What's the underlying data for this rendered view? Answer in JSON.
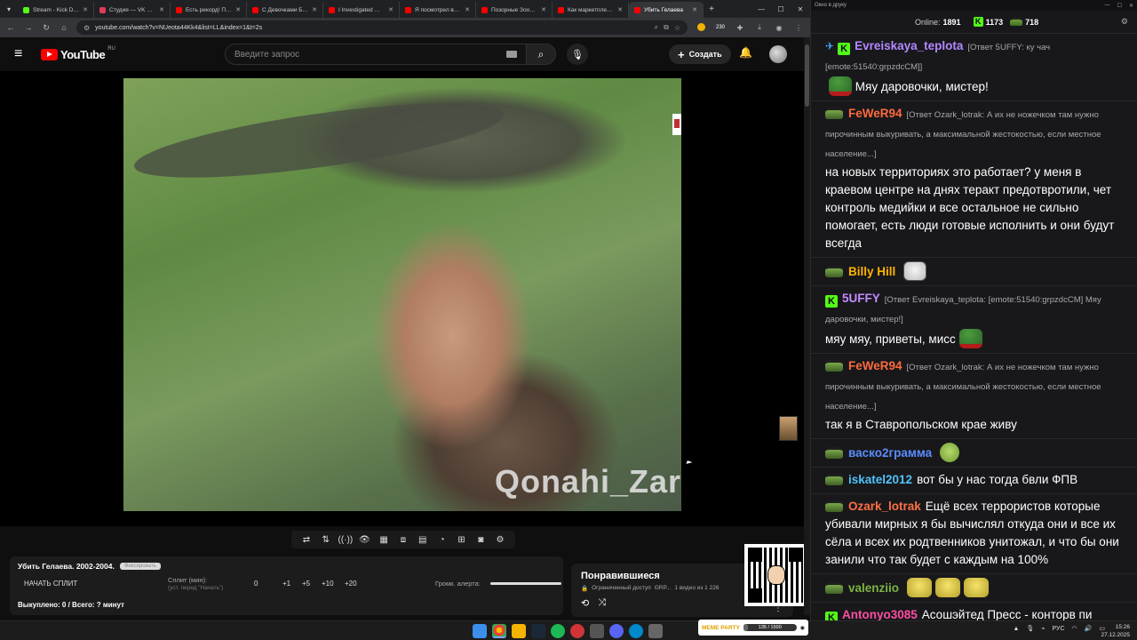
{
  "browser": {
    "tabs": [
      {
        "label": "Stream - Kick Dash",
        "color": "#53fc18",
        "active": false
      },
      {
        "label": "Студия — VK Видео",
        "color": "#e33b5a",
        "active": false
      },
      {
        "label": "Есть рекорд! Пере",
        "color": "#ff0000",
        "active": false
      },
      {
        "label": "С Девочками Бол",
        "color": "#ff0000",
        "active": false
      },
      {
        "label": "I Investigated Mine",
        "color": "#ff0000",
        "active": false
      },
      {
        "label": "Я посмотрел все о",
        "color": "#ff0000",
        "active": false
      },
      {
        "label": "Позорные Зоозащ",
        "color": "#ff0000",
        "active": false
      },
      {
        "label": "Как маркетплейсы",
        "color": "#ff0000",
        "active": false
      },
      {
        "label": "Убить Гелаева",
        "color": "#ff0000",
        "active": true
      }
    ],
    "url": "youtube.com/watch?v=NUeota44Kk4&list=LL&index=1&t=2s",
    "ext_badge": "230"
  },
  "youtube": {
    "logo": "YouTube",
    "region": "RU",
    "search_placeholder": "Введите запрос",
    "create_label": "Создать"
  },
  "video": {
    "watermark": "Qonahi_Zar"
  },
  "split": {
    "title": "Убить Гелаева. 2002-2004.",
    "pill": "Фиксировать",
    "start_label": "НАЧАТЬ СПЛИТ",
    "split_label": "Сплит (мин):",
    "split_hint": "(уст. перед \"Начать\")",
    "value": "0",
    "increments": [
      "+1",
      "+5",
      "+10",
      "+20"
    ],
    "alert_label": "Громк. алерта:",
    "alert_volume": 1.0,
    "footer": "Выкуплено: 0 / Всего: ? минут"
  },
  "liked": {
    "title": "Понравившиеся",
    "access": "Ограниченный доступ",
    "owner": "GRP...",
    "count": "1 видео из 1 226"
  },
  "chat": {
    "window_title": "Окно в друку",
    "online_label": "Online:",
    "online_count": "1891",
    "kick_count": "1173",
    "sub_count": "718",
    "messages": [
      {
        "user": "Evreiskaya_teplota",
        "color": "#b388ff",
        "badge": "sword-k",
        "reply": "[Ответ 5UFFY: ку чач [emote:51540:grpzdcCM]]",
        "text": "Мяу даровочки, мистер!",
        "emote_before": "pepe-red",
        "emote_after": ""
      },
      {
        "user": "FeWeR94",
        "color": "#ff6a3d",
        "badge": "pepe",
        "reply": "[Ответ Ozark_lotrak: А их не ножечком там нужно пирочинным выкуривать, а максимальной жестокостью, если местное население...]",
        "text": "на новых территориях это работает? у меня в краевом центре на днях теракт предотвротили, чет контроль медийки и все остальное не сильно помогает, есть люди готовые исполнить и они будут всегда",
        "emote_before": "",
        "emote_after": ""
      },
      {
        "user": "Billy Hill",
        "color": "#ffb300",
        "badge": "pepe",
        "reply": "",
        "text": "",
        "emote_before": "",
        "emote_after": "troll"
      },
      {
        "user": "5UFFY",
        "color": "#c58bff",
        "badge": "k",
        "reply": "[Ответ Evreiskaya_teplota: [emote:51540:grpzdcCM] Мяу даровочки, мистер!]",
        "text": "мяу мяу, приветы, мисс",
        "emote_before": "",
        "emote_after": "pepe-red"
      },
      {
        "user": "FeWeR94",
        "color": "#ff6a3d",
        "badge": "pepe",
        "reply": "[Ответ Ozark_lotrak: А их не ножечком там нужно пирочинным выкуривать, а максимальной жестокостью, если местное население...]",
        "text": "так я в Ставропольском крае живу",
        "emote_before": "",
        "emote_after": ""
      },
      {
        "user": "васко2грамма",
        "color": "#5b8cff",
        "badge": "pepe",
        "reply": "",
        "text": "",
        "emote_before": "",
        "emote_after": "sick"
      },
      {
        "user": "iskatel2012",
        "color": "#4fc3f7",
        "badge": "pepe",
        "reply": "",
        "text": "вот бы у нас тогда бвли ФПВ",
        "emote_before": "",
        "emote_after": ""
      },
      {
        "user": "Ozark_lotrak",
        "color": "#ff7043",
        "badge": "pepe",
        "reply": "",
        "text": "Ещё всех террористов которые убивали мирных я бы вычислял откуда они и все их сёла и всех их родтвенников унитожал, и что бы они занили что так будет с каждым на 100%",
        "emote_before": "",
        "emote_after": ""
      },
      {
        "user": "valenziio",
        "color": "#7cb342",
        "badge": "pepe",
        "reply": "",
        "text": "",
        "emote_before": "",
        "emote_after": "yellow3"
      },
      {
        "user": "Antonyo3085",
        "color": "#ff4fa3",
        "badge": "k",
        "reply": "",
        "text": "Асошэйтед Пресс - конторв пи дарасов",
        "emote_before": "",
        "emote_after": "fire"
      }
    ]
  },
  "taskbar": {
    "meme_party_logo": "MEME PARTY",
    "meme_party_progress": "135 / 1500",
    "meme_party_fraction": 0.09,
    "lang": "РУС",
    "time": "15:26",
    "date": "27.12.2025"
  }
}
